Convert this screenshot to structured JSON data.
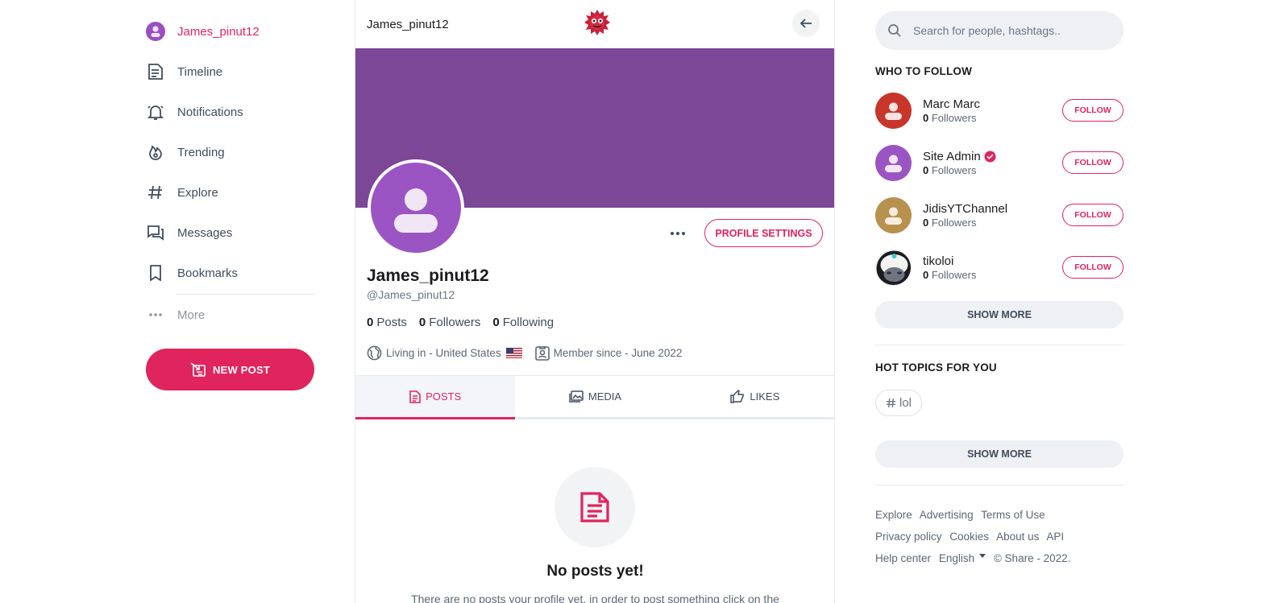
{
  "sidebar": {
    "profile_label": "James_pinut12",
    "items": [
      {
        "label": "Timeline",
        "icon": "timeline-icon"
      },
      {
        "label": "Notifications",
        "icon": "bell-icon"
      },
      {
        "label": "Trending",
        "icon": "flame-icon"
      },
      {
        "label": "Explore",
        "icon": "hashtag-icon"
      },
      {
        "label": "Messages",
        "icon": "messages-icon"
      },
      {
        "label": "Bookmarks",
        "icon": "bookmark-icon"
      }
    ],
    "more_label": "More",
    "new_post_label": "NEW POST"
  },
  "header": {
    "username": "James_pinut12",
    "logo_icon": "share-logo-icon"
  },
  "profile": {
    "name": "James_pinut12",
    "handle": "@James_pinut12",
    "posts_count": "0",
    "posts_label": "Posts",
    "followers_count": "0",
    "followers_label": "Followers",
    "following_count": "0",
    "following_label": "Following",
    "location": "Living in - United States",
    "member_since": "Member since - June 2022",
    "settings_label": "PROFILE SETTINGS",
    "cover_color": "#7b4796",
    "avatar_color": "#9b55c3"
  },
  "tabs": [
    {
      "label": "POSTS",
      "active": true
    },
    {
      "label": "MEDIA",
      "active": false
    },
    {
      "label": "LIKES",
      "active": false
    }
  ],
  "empty_state": {
    "title": "No posts yet!",
    "description": "There are no posts your profile yet, in order to post something click on the"
  },
  "right": {
    "search_placeholder": "Search for people, hashtags..",
    "who_to_follow_title": "WHO TO FOLLOW",
    "follow_label": "FOLLOW",
    "followers_label": "Followers",
    "suggestions": [
      {
        "name": "Marc Marc",
        "followers": "0",
        "avatar_color": "#c7352b",
        "verified": false
      },
      {
        "name": "Site Admin",
        "followers": "0",
        "avatar_color": "#9b55c3",
        "verified": true
      },
      {
        "name": "JidisYTChannel",
        "followers": "0",
        "avatar_color": "#b8914f",
        "verified": false
      },
      {
        "name": "tikoloi",
        "followers": "0",
        "avatar_color": "#ffffff",
        "verified": false
      }
    ],
    "show_more_label": "SHOW MORE",
    "hot_topics_title": "HOT TOPICS FOR YOU",
    "topics": [
      "lol"
    ],
    "footer_links": [
      "Explore",
      "Advertising",
      "Terms of Use",
      "Privacy policy",
      "Cookies",
      "About us",
      "API",
      "Help center"
    ],
    "language": "English",
    "copyright": "© Share - 2022."
  },
  "colors": {
    "accent": "#e0245e",
    "text_muted": "#5c6775"
  }
}
